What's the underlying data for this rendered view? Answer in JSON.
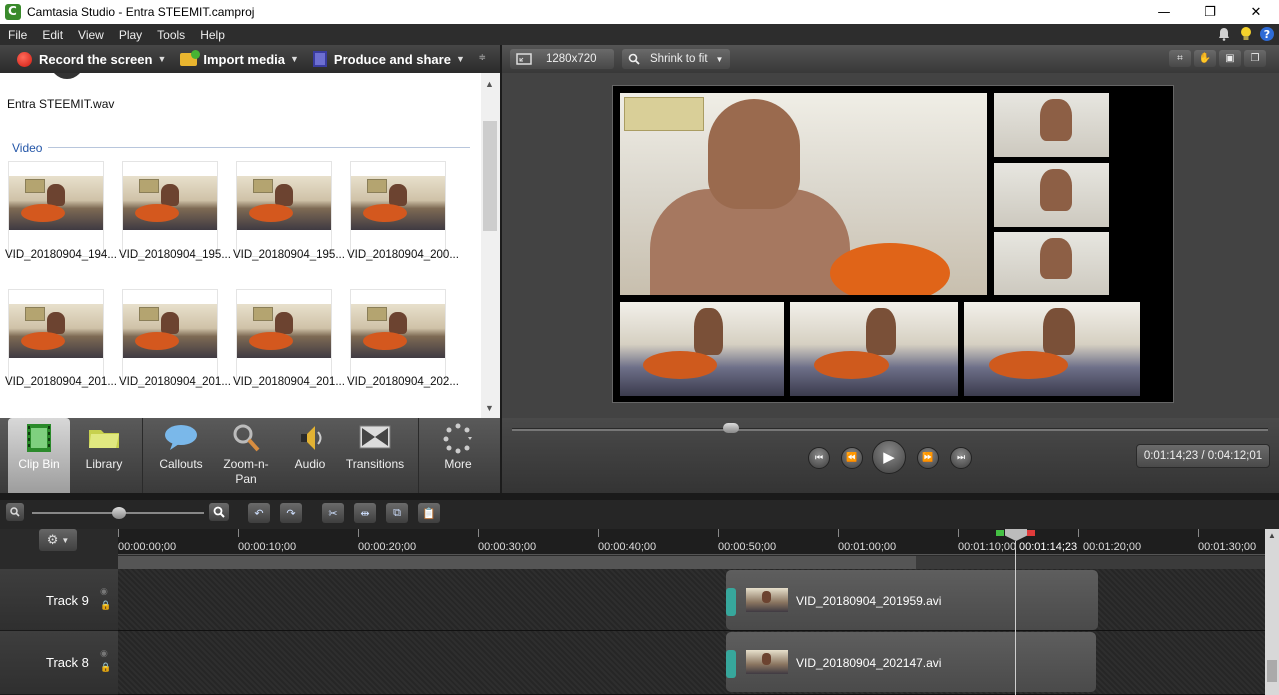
{
  "window": {
    "title": "Camtasia Studio - Entra STEEMIT.camproj",
    "minimize_glyph": "—",
    "maximize_glyph": "❐",
    "close_glyph": "✕"
  },
  "menu": [
    "File",
    "Edit",
    "View",
    "Play",
    "Tools",
    "Help"
  ],
  "menu_icons": [
    "bell-icon",
    "lightbulb-icon",
    "help-icon"
  ],
  "left_toolbar": {
    "record": "Record the screen",
    "import": "Import media",
    "produce": "Produce and share"
  },
  "clip_bin": {
    "audio_file": "Entra STEEMIT.wav",
    "video_header": "Video",
    "clips": [
      "VID_20180904_194...",
      "VID_20180904_195...",
      "VID_20180904_195...",
      "VID_20180904_200...",
      "VID_20180904_201...",
      "VID_20180904_201...",
      "VID_20180904_201...",
      "VID_20180904_202..."
    ]
  },
  "tasks": [
    {
      "label": "Clip Bin",
      "icon": "film-strip-icon",
      "active": true
    },
    {
      "label": "Library",
      "icon": "library-folder-icon",
      "active": false
    },
    {
      "label": "Callouts",
      "icon": "speech-bubble-icon",
      "active": false
    },
    {
      "label": "Zoom-n-Pan",
      "icon": "magnifier-icon",
      "active": false
    },
    {
      "label": "Audio",
      "icon": "speaker-icon",
      "active": false
    },
    {
      "label": "Transitions",
      "icon": "transition-icon",
      "active": false
    },
    {
      "label": "More",
      "icon": "more-dots-icon",
      "active": false
    }
  ],
  "preview": {
    "dimensions": "1280x720",
    "fit_mode": "Shrink to fit",
    "time": "0:01:14;23 / 0:04:12;01",
    "scrub_position": 0.29
  },
  "timeline": {
    "ruler_labels": [
      "00:00:00;00",
      "00:00:10;00",
      "00:00:20;00",
      "00:00:30;00",
      "00:00:40;00",
      "00:00:50;00",
      "00:01:00;00",
      "00:01:10;00",
      "00:01:20;00",
      "00:01:30;00"
    ],
    "playhead_label": "00:01:14;23",
    "tracks": [
      {
        "name": "Track 9",
        "clip": "VID_20180904_201959.avi"
      },
      {
        "name": "Track 8",
        "clip": "VID_20180904_202147.avi"
      }
    ]
  }
}
